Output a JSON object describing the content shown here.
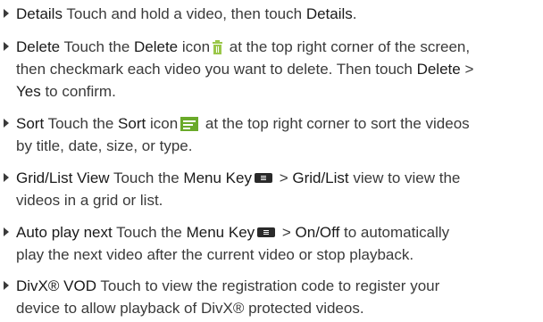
{
  "items": [
    {
      "label": "Details",
      "text": " Touch and hold a video, then touch ",
      "t2": "Details",
      "t3": "."
    },
    {
      "label": "Delete",
      "a": " Touch the ",
      "b": "Delete",
      "c": " icon",
      "d": " at the top right corner of the screen,",
      "line2": "then checkmark each video you want to delete. Then touch ",
      "line2b": "Delete",
      "line2c": " >",
      "line3": "Yes",
      "line3b": " to confirm.",
      "icon": "trash-icon"
    },
    {
      "label": "Sort",
      "a": " Touch the ",
      "b": "Sort",
      "c": " icon",
      "d": " at the top right corner to sort the videos",
      "line2": "by title, date, size, or type.",
      "icon": "sort-icon"
    },
    {
      "label": "Grid/List View",
      "a": " Touch the ",
      "b": "Menu Key",
      "c": " > ",
      "d": "Grid/List",
      "e": " view to view the",
      "line2": "videos in a grid or list.",
      "icon": "menu-key-icon"
    },
    {
      "label": "Auto play next",
      "a": " Touch the ",
      "b": "Menu Key",
      "c": " > ",
      "d": "On/Off",
      "e": " to automatically",
      "line2": "play the next video after the current video or stop playback.",
      "icon": "menu-key-icon"
    },
    {
      "label": "DivX® VOD",
      "a": " Touch to view the registration code to register your",
      "line2": "device to allow playback of DivX® protected videos."
    }
  ],
  "colors": {
    "text": "#3a3a3a",
    "trash_icon": "#9bc74a",
    "sort_icon": "#6aaa2a",
    "menu_key": "#2a2a2a"
  }
}
